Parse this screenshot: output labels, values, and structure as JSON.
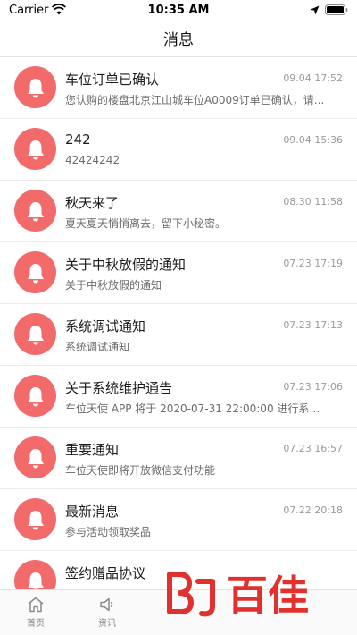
{
  "status_bar": {
    "carrier": "Carrier",
    "time": "10:35 AM"
  },
  "header": {
    "title": "消息"
  },
  "messages": [
    {
      "title": "车位订单已确认",
      "time": "09.04 17:52",
      "subtitle": "您认购的楼盘北京江山城车位A0009订单已确认，请..."
    },
    {
      "title": "242",
      "time": "09.04 15:36",
      "subtitle": "42424242"
    },
    {
      "title": "秋天来了",
      "time": "08.30 11:58",
      "subtitle": "夏天夏天悄悄离去，留下小秘密。"
    },
    {
      "title": "关于中秋放假的通知",
      "time": "07.23 17:19",
      "subtitle": "关于中秋放假的通知"
    },
    {
      "title": "系统调试通知",
      "time": "07.23 17:13",
      "subtitle": "系统调试通知"
    },
    {
      "title": "关于系统维护通告",
      "time": "07.23 17:06",
      "subtitle": "车位天使 APP 将于 2020-07-31 22:00:00 进行系统维..."
    },
    {
      "title": "重要通知",
      "time": "07.23 16:57",
      "subtitle": "车位天使即将开放微信支付功能"
    },
    {
      "title": "最新消息",
      "time": "07.22 20:18",
      "subtitle": "参与活动领取奖品"
    },
    {
      "title": "签约赠品协议",
      "time": "",
      "subtitle": ""
    }
  ],
  "tabs": [
    {
      "label": "首页",
      "icon": "home-icon"
    },
    {
      "label": "资讯",
      "icon": "speaker-icon"
    }
  ],
  "watermark": {
    "text": "百佳"
  },
  "colors": {
    "avatar": "#f36a6a",
    "watermark": "#e0312e"
  }
}
